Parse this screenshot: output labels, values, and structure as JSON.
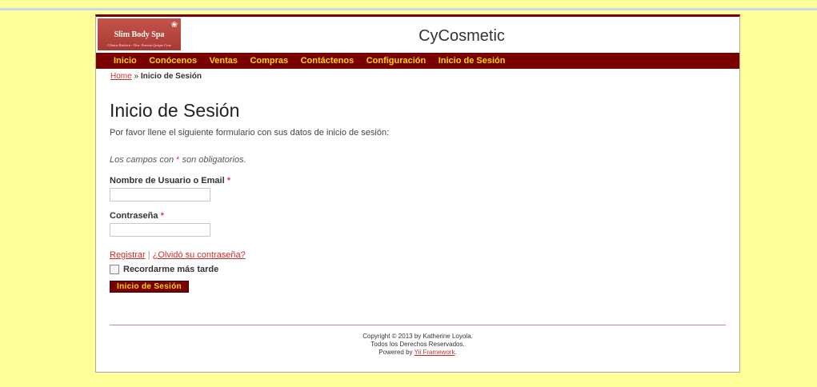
{
  "logo": {
    "name": "Slim Body Spa",
    "tagline": "Clínica Estética - Dra. Yesenia Quispe Cruz",
    "flower_icon": "flower-icon"
  },
  "site_title": "CyCosmetic",
  "menu": [
    "Inicio",
    "Conócenos",
    "Ventas",
    "Compras",
    "Contáctenos",
    "Configuración",
    "Inicio de Sesión"
  ],
  "breadcrumb": {
    "home": "Home",
    "separator": "»",
    "current": "Inicio de Sesión"
  },
  "page": {
    "title": "Inicio de Sesión",
    "intro": "Por favor llene el siguiente formulario con sus datos de inicio de sesión:",
    "note_prefix": "Los campos con",
    "note_star": "*",
    "note_suffix": "son obligatorios."
  },
  "form": {
    "username_label": "Nombre de Usuario o Email",
    "username_value": "",
    "password_label": "Contraseña",
    "password_value": "",
    "required_mark": "*",
    "register_link": "Registrar",
    "link_separator": "|",
    "forgot_link": "¿Olvidó su contraseña?",
    "remember_label": "Recordarme más tarde",
    "remember_checked": false,
    "submit_label": "Inicio de Sesión"
  },
  "footer": {
    "copyright": "Copyright © 2013 by Katherine Loyola.",
    "rights": "Todos los Derechos Reservados.",
    "powered_prefix": "Powered by",
    "powered_link": "Yii Framework",
    "powered_suffix": "."
  },
  "colors": {
    "page_background": "#ffff99",
    "menu_background": "#7a0000",
    "menu_text": "#ffd700",
    "link": "#c9302c",
    "required": "#e23b3b"
  }
}
